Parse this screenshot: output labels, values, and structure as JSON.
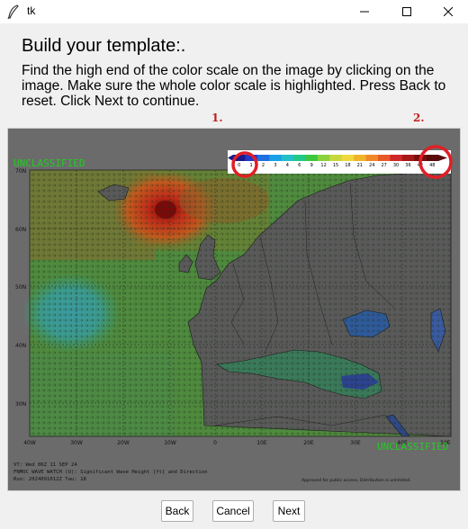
{
  "window": {
    "title": "tk",
    "icon": "feather-icon"
  },
  "heading": "Build your template:.",
  "instructions": "Find the high end of the color scale on the image by clicking on the image. Make sure the whole color scale is highlighted. Press Back to reset. Click Next to continue.",
  "markers": {
    "first": "1.",
    "second": "2."
  },
  "map": {
    "classification_top": "UNCLASSIFIED",
    "classification_bottom": "UNCLASSIFIED",
    "colorbar_ticks": [
      "0",
      "1",
      "2",
      "3",
      "4",
      "6",
      "9",
      "12",
      "15",
      "18",
      "21",
      "24",
      "27",
      "30",
      "36",
      "42",
      "48"
    ],
    "lat_labels": [
      "70N",
      "60N",
      "50N",
      "40N",
      "30N"
    ],
    "lon_labels": [
      "40W",
      "30W",
      "20W",
      "10W",
      "0",
      "10E",
      "20E",
      "30E",
      "40E",
      "50E"
    ],
    "footer_lines": [
      "VT: Wed 06Z 11 SEP 24",
      "FNMOC WAVE WATCH (U): Significant Wave Height [ft] and Direction",
      "Run: 2024091012Z Tau: 18"
    ],
    "approved_note": "Approved for public access. Distribution is unlimited.",
    "highlight_color": "#e01f26",
    "class_color": "#22cc22"
  },
  "buttons": {
    "back": "Back",
    "cancel": "Cancel",
    "next": "Next"
  }
}
